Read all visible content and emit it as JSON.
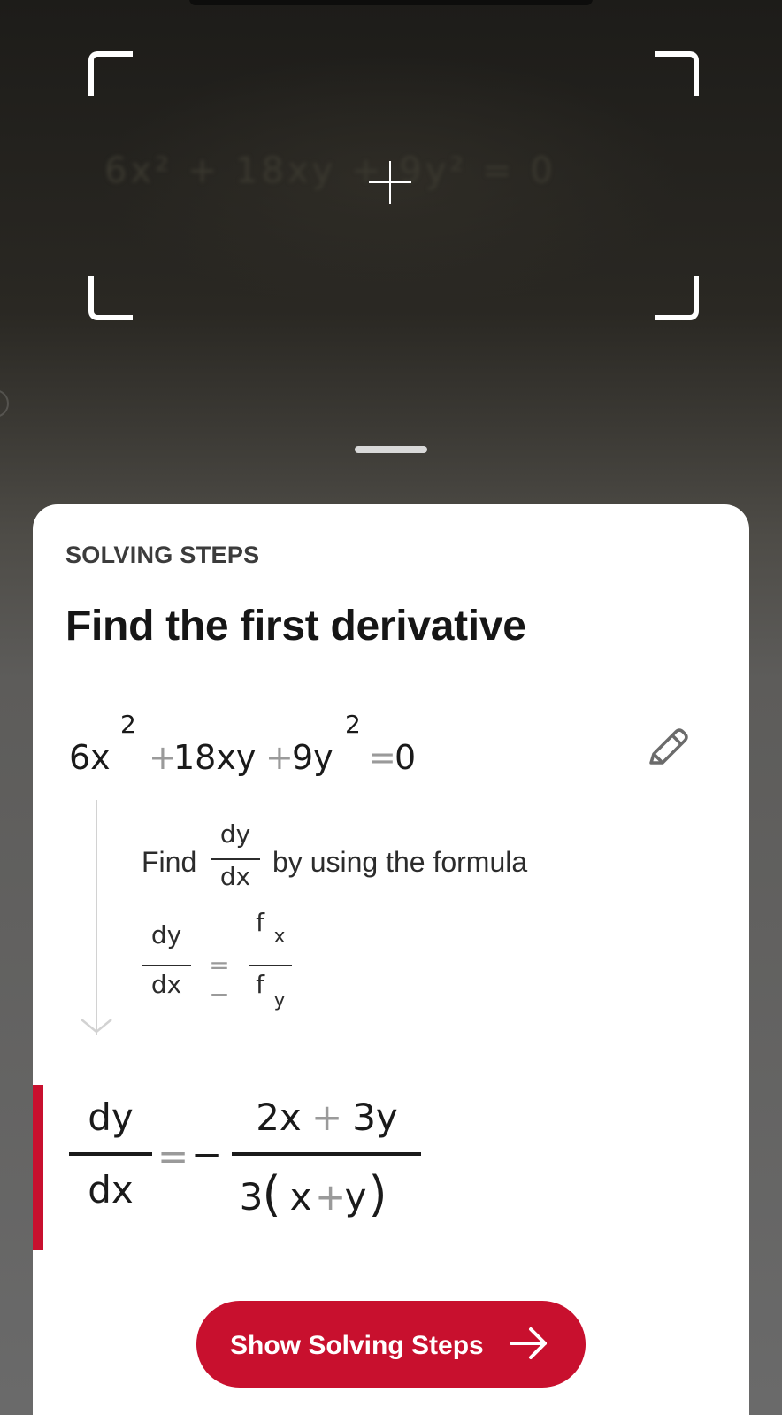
{
  "camera": {
    "handwriting": "6x² + 18xy + 9y² = 0"
  },
  "sheet": {
    "section_label": "SOLVING STEPS",
    "step_title": "Find the first derivative",
    "equation": {
      "t1": "6x",
      "e1": "2",
      "op1": "+",
      "t2": "18xy",
      "op2": "+",
      "t3": "9y",
      "e2": "2",
      "op3": "=",
      "rhs": "0"
    },
    "hint": {
      "prefix": "Find",
      "frac_num": "dy",
      "frac_den": "dx",
      "suffix": "by using the formula"
    },
    "formula": {
      "lhs_num": "dy",
      "lhs_den": "dx",
      "eq": "= −",
      "rhs_num": "f",
      "rhs_num_sub": "x",
      "rhs_den": "f",
      "rhs_den_sub": "y"
    },
    "result": {
      "lhs_num": "dy",
      "lhs_den": "dx",
      "eq": "=",
      "minus": "−",
      "num_a": "2x",
      "num_op": "+",
      "num_b": "3y",
      "den_coef": "3",
      "den_open": "(",
      "den_a": "x",
      "den_op": "+",
      "den_b": "y",
      "den_close": ")"
    },
    "cta": {
      "label": "Show Solving Steps",
      "icon": "arrow-right-icon"
    }
  },
  "colors": {
    "accent": "#c8102e",
    "operator": "#9a9a9a"
  }
}
